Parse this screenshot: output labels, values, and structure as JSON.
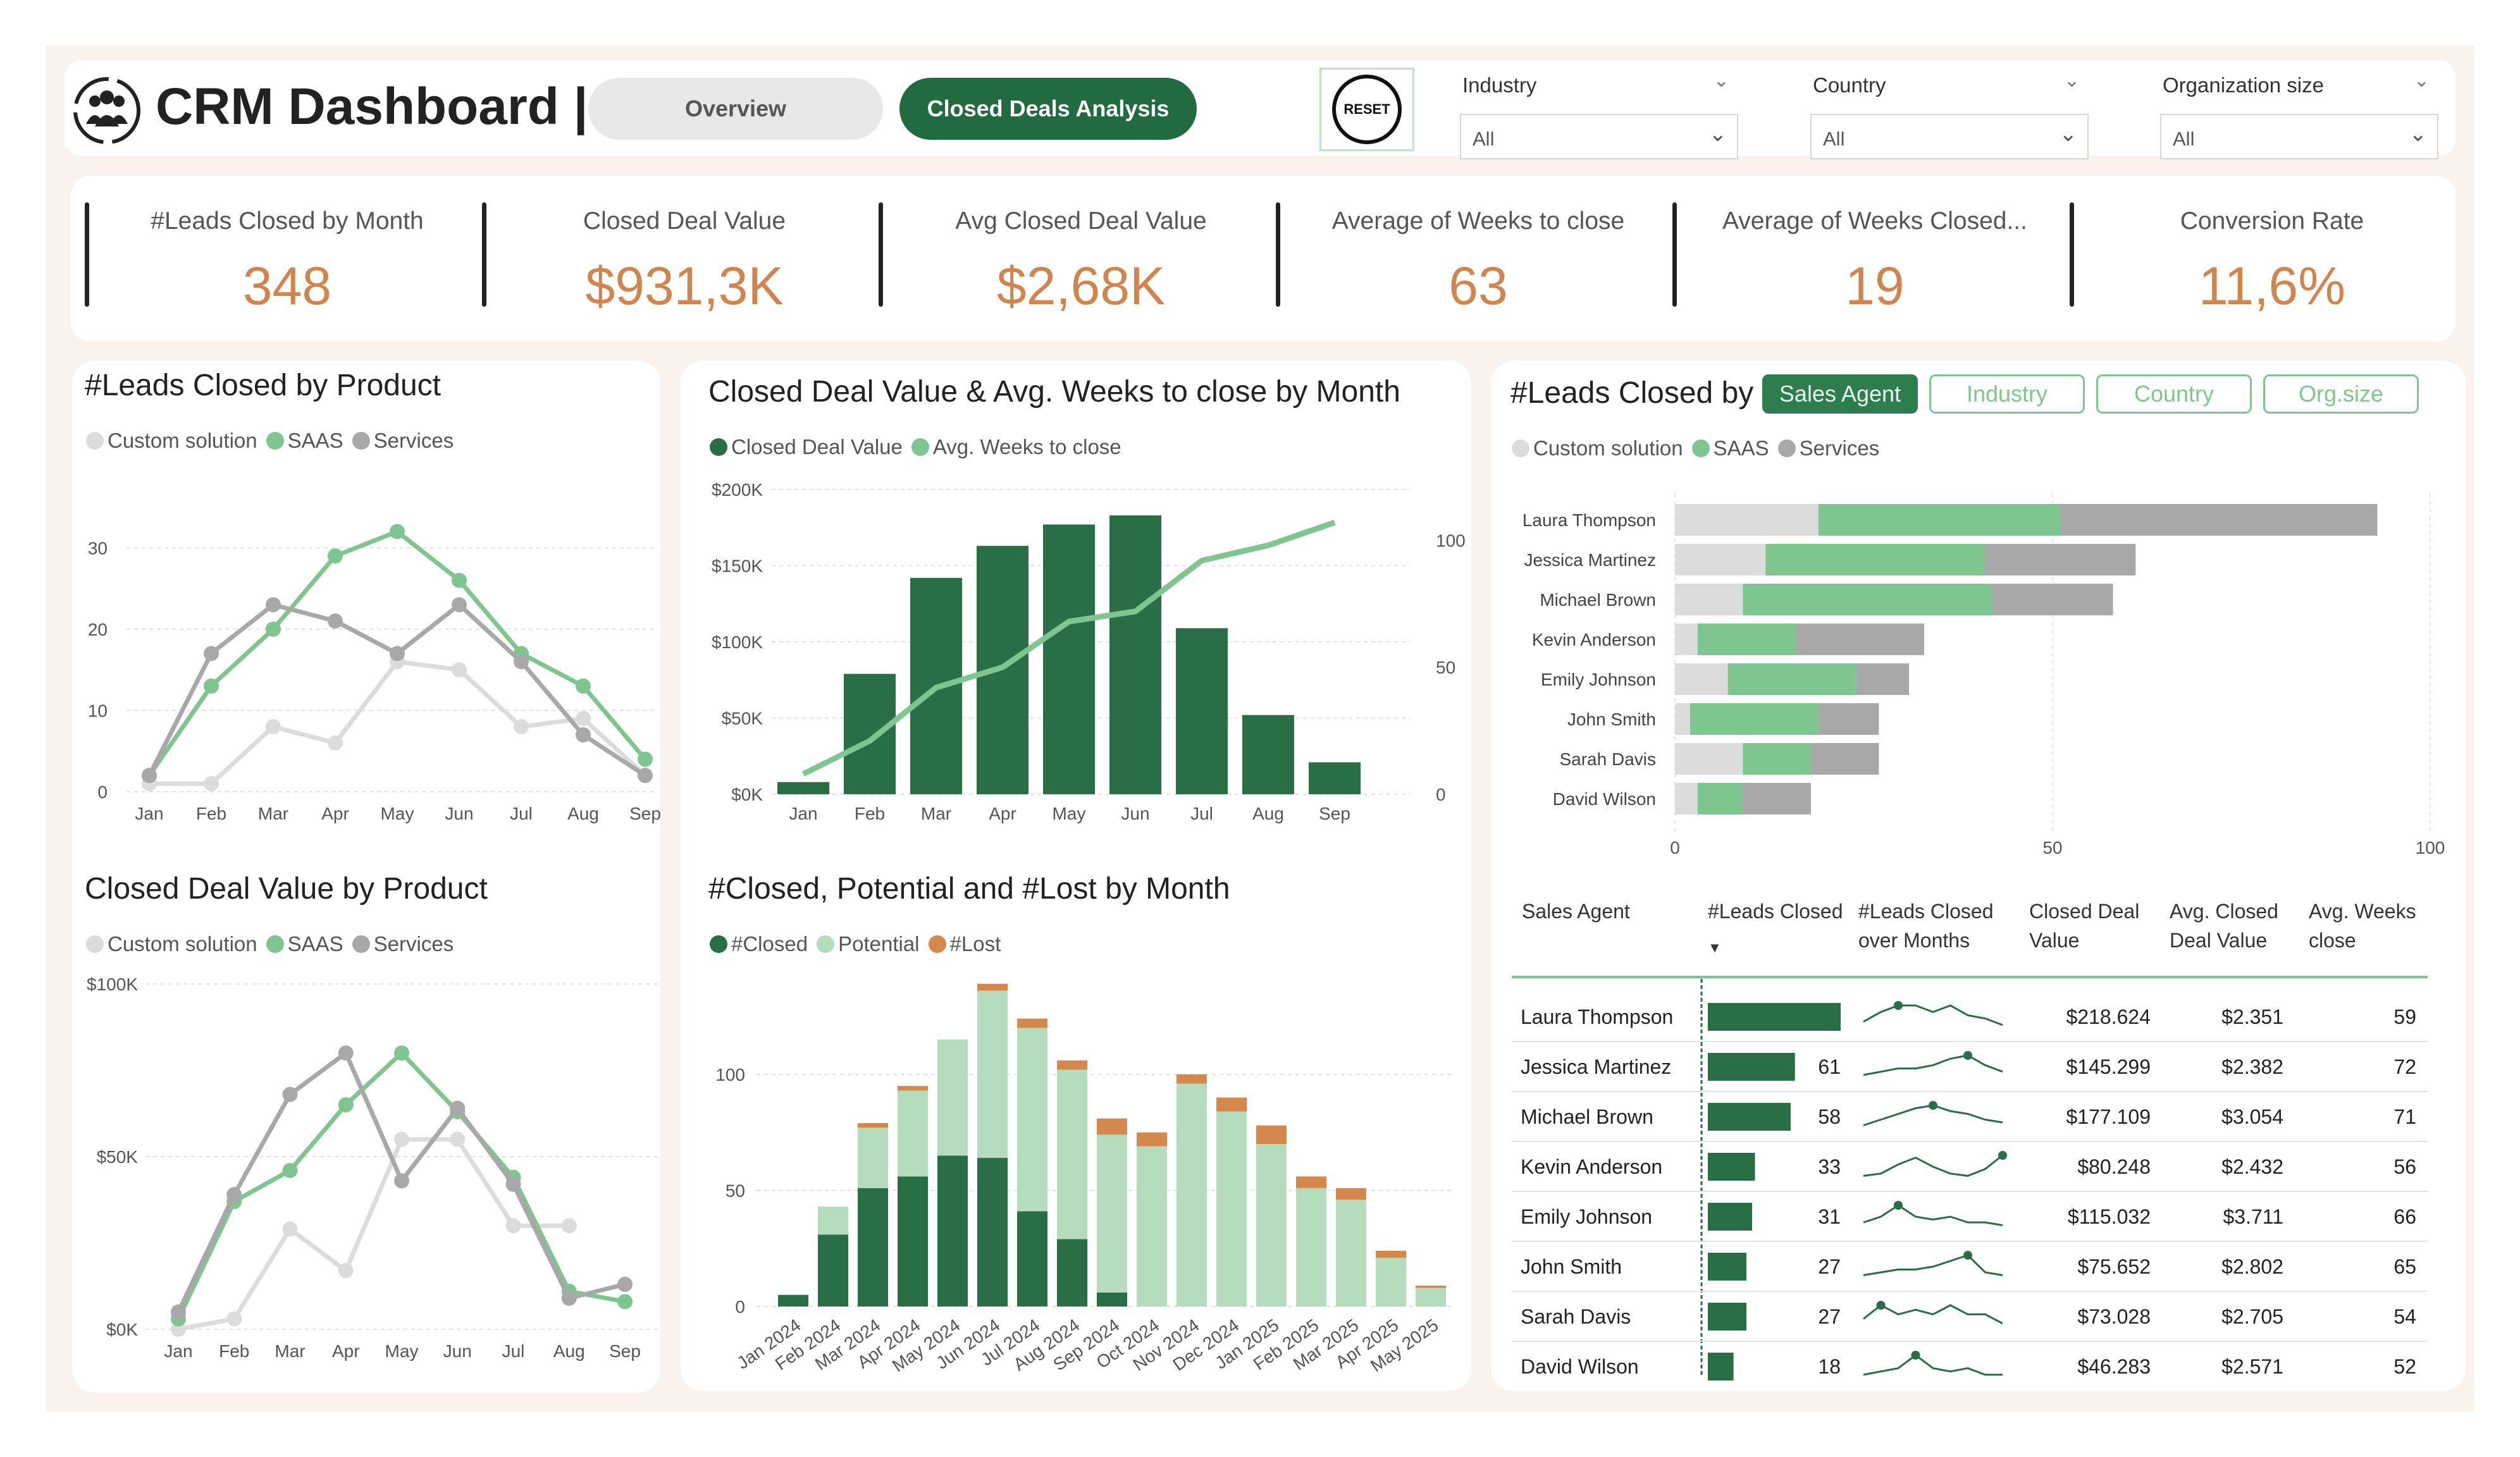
{
  "header": {
    "title": "CRM Dashboard |",
    "tabs": [
      {
        "label": "Overview"
      },
      {
        "label": "Closed Deals Analysis"
      }
    ],
    "reset_label": "RESET",
    "filters": [
      {
        "label": "Industry",
        "value": "All"
      },
      {
        "label": "Country",
        "value": "All"
      },
      {
        "label": "Organization size",
        "value": "All"
      }
    ]
  },
  "kpis": [
    {
      "label": "#Leads Closed by Month",
      "value": "348"
    },
    {
      "label": "Closed Deal Value",
      "value": "$931,3K"
    },
    {
      "label": "Avg Closed Deal Value",
      "value": "$2,68K"
    },
    {
      "label": "Average of Weeks to close",
      "value": "63"
    },
    {
      "label": "Average of Weeks Closed...",
      "value": "19"
    },
    {
      "label": "Conversion Rate",
      "value": "11,6%"
    }
  ],
  "colors": {
    "custom_solution": "#dcdcdc",
    "saas": "#7fc58f",
    "services": "#a8a8a8",
    "dark_green": "#2a6e46",
    "light_green": "#b5dcbc",
    "lost": "#d4884e",
    "kpi_value": "#d0854f"
  },
  "chart_data": [
    {
      "type": "line",
      "title": "#Leads Closed by Product",
      "categories": [
        "Jan",
        "Feb",
        "Mar",
        "Apr",
        "May",
        "Jun",
        "Jul",
        "Aug",
        "Sep"
      ],
      "series": [
        {
          "name": "Custom solution",
          "values": [
            1,
            1,
            8,
            6,
            16,
            15,
            8,
            9,
            2
          ]
        },
        {
          "name": "SAAS",
          "values": [
            2,
            13,
            20,
            29,
            32,
            26,
            17,
            13,
            4
          ]
        },
        {
          "name": "Services",
          "values": [
            2,
            17,
            23,
            21,
            17,
            23,
            16,
            7,
            2
          ]
        }
      ],
      "y_ticks": [
        "0",
        "10",
        "20",
        "30"
      ],
      "ylim": [
        0,
        35
      ]
    },
    {
      "type": "line",
      "title": "Closed Deal Value by Product",
      "categories": [
        "Jan",
        "Feb",
        "Mar",
        "Apr",
        "May",
        "Jun",
        "Jul",
        "Aug",
        "Sep"
      ],
      "series": [
        {
          "name": "Custom solution",
          "values": [
            0,
            3000,
            29000,
            17000,
            55000,
            55000,
            30000,
            30000,
            null
          ]
        },
        {
          "name": "SAAS",
          "values": [
            3000,
            37000,
            46000,
            65000,
            80000,
            63000,
            44000,
            11000,
            8000
          ]
        },
        {
          "name": "Services",
          "values": [
            5000,
            39000,
            68000,
            80000,
            43000,
            64000,
            42000,
            9000,
            13000
          ]
        }
      ],
      "y_ticks": [
        "$0K",
        "$50K",
        "$100K"
      ],
      "ylim": [
        0,
        100000
      ]
    },
    {
      "type": "bar",
      "title": "Closed Deal Value & Avg. Weeks to close by Month",
      "categories": [
        "Jan",
        "Feb",
        "Mar",
        "Apr",
        "May",
        "Jun",
        "Jul",
        "Aug",
        "Sep"
      ],
      "series": [
        {
          "name": "Closed Deal Value",
          "values": [
            8000,
            79000,
            142000,
            163000,
            177000,
            183000,
            109000,
            52000,
            21000
          ]
        },
        {
          "name": "Avg. Weeks to close",
          "values": [
            8,
            21,
            42,
            50,
            68,
            72,
            92,
            98,
            107
          ]
        }
      ],
      "y_ticks": [
        "$0K",
        "$50K",
        "$100K",
        "$150K",
        "$200K"
      ],
      "y2_ticks": [
        "0",
        "50",
        "100"
      ],
      "ylim": [
        0,
        200000
      ],
      "y2lim": [
        0,
        100
      ]
    },
    {
      "type": "bar",
      "title": "#Closed, Potential and #Lost by Month",
      "categories": [
        "Jan 2024",
        "Feb 2024",
        "Mar 2024",
        "Apr 2024",
        "May 2024",
        "Jun 2024",
        "Jul 2024",
        "Aug 2024",
        "Sep 2024",
        "Oct 2024",
        "Nov 2024",
        "Dec 2024",
        "Jan 2025",
        "Feb 2025",
        "Mar 2025",
        "Apr 2025",
        "May 2025"
      ],
      "series": [
        {
          "name": "#Closed",
          "values": [
            5,
            31,
            51,
            56,
            65,
            64,
            41,
            29,
            6,
            0,
            0,
            0,
            0,
            0,
            0,
            0,
            0
          ]
        },
        {
          "name": "Potential",
          "values": [
            0,
            12,
            26,
            37,
            50,
            72,
            79,
            73,
            68,
            69,
            96,
            84,
            70,
            51,
            46,
            21,
            8
          ]
        },
        {
          "name": "#Lost",
          "values": [
            0,
            0,
            2,
            2,
            0,
            3,
            4,
            4,
            7,
            6,
            4,
            6,
            8,
            5,
            5,
            3,
            1
          ]
        }
      ],
      "y_ticks": [
        "0",
        "50",
        "100"
      ],
      "ylim": [
        0,
        140
      ]
    },
    {
      "type": "bar",
      "title": "#Leads Closed by",
      "categories": [
        "Laura Thompson",
        "Jessica Martinez",
        "Michael Brown",
        "Kevin Anderson",
        "Emily Johnson",
        "John Smith",
        "Sarah Davis",
        "David Wilson"
      ],
      "series": [
        {
          "name": "Custom solution",
          "values": [
            19,
            12,
            9,
            3,
            7,
            2,
            9,
            3
          ]
        },
        {
          "name": "SAAS",
          "values": [
            32,
            29,
            33,
            13,
            17,
            17,
            9,
            6
          ]
        },
        {
          "name": "Services",
          "values": [
            42,
            20,
            16,
            17,
            7,
            8,
            9,
            9
          ]
        }
      ],
      "x_ticks": [
        "0",
        "50",
        "100"
      ],
      "xlim": [
        0,
        100
      ]
    }
  ],
  "leads_by": {
    "title": "#Leads Closed by",
    "buttons": [
      "Sales Agent",
      "Industry",
      "Country",
      "Org.size"
    ],
    "legend": [
      "Custom solution",
      "SAAS",
      "Services"
    ]
  },
  "table": {
    "headers": [
      "Sales Agent",
      "#Leads Closed",
      "#Leads Closed over Months",
      "Closed Deal Value",
      "Avg. Closed Deal Value",
      "Avg. Weeks close"
    ],
    "rows": [
      {
        "agent": "Laura Thompson",
        "leads": 93,
        "spark": [
          2,
          5,
          7,
          7,
          5,
          7,
          4,
          3,
          1
        ],
        "value": "$218.624",
        "avg": "$2.351",
        "weeks": 59
      },
      {
        "agent": "Jessica Martinez",
        "leads": 61,
        "spark": [
          1,
          2,
          3,
          3,
          4,
          6,
          7,
          4,
          2
        ],
        "value": "$145.299",
        "avg": "$2.382",
        "weeks": 72
      },
      {
        "agent": "Michael Brown",
        "leads": 58,
        "spark": [
          1,
          3,
          5,
          7,
          8,
          6,
          5,
          3,
          2
        ],
        "value": "$177.109",
        "avg": "$3.054",
        "weeks": 71
      },
      {
        "agent": "Kevin Anderson",
        "leads": 33,
        "spark": [
          1,
          2,
          6,
          9,
          5,
          2,
          1,
          4,
          10
        ],
        "value": "$80.248",
        "avg": "$2.432",
        "weeks": 56
      },
      {
        "agent": "Emily Johnson",
        "leads": 31,
        "spark": [
          2,
          4,
          8,
          4,
          3,
          4,
          2,
          2,
          1
        ],
        "value": "$115.032",
        "avg": "$3.711",
        "weeks": 66
      },
      {
        "agent": "John Smith",
        "leads": 27,
        "spark": [
          1,
          2,
          3,
          3,
          4,
          6,
          8,
          2,
          1
        ],
        "value": "$75.652",
        "avg": "$2.802",
        "weeks": 65
      },
      {
        "agent": "Sarah Davis",
        "leads": 27,
        "spark": [
          2,
          5,
          3,
          4,
          3,
          5,
          3,
          3,
          1
        ],
        "value": "$73.028",
        "avg": "$2.705",
        "weeks": 54
      },
      {
        "agent": "David Wilson",
        "leads": 18,
        "spark": [
          1,
          2,
          3,
          7,
          3,
          2,
          3,
          1,
          1
        ],
        "value": "$46.283",
        "avg": "$2.571",
        "weeks": 52
      }
    ],
    "max_leads": 93
  }
}
